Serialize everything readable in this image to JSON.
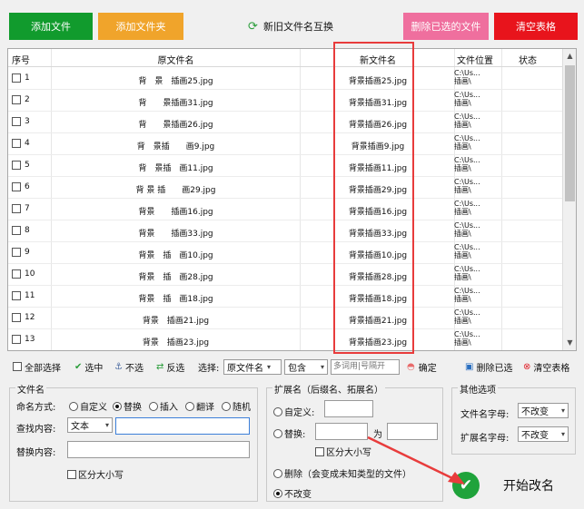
{
  "toolbar": {
    "add_file": "添加文件",
    "add_folder": "添加文件夹",
    "swap": "新旧文件名互换",
    "delete_selected": "删除已选的文件",
    "clear_table": "清空表格"
  },
  "grid": {
    "headers": {
      "index": "序号",
      "original": "原文件名",
      "new": "新文件名",
      "location": "文件位置",
      "status": "状态"
    },
    "rows": [
      {
        "index": "1",
        "original": "背　景　插画25.jpg",
        "new": "背景插画25.jpg",
        "location": "C:\\Us...\n插画\\"
      },
      {
        "index": "2",
        "original": "背　　景插画31.jpg",
        "new": "背景插画31.jpg",
        "location": "C:\\Us...\n插画\\"
      },
      {
        "index": "3",
        "original": "背　　景插画26.jpg",
        "new": "背景插画26.jpg",
        "location": "C:\\Us...\n插画\\"
      },
      {
        "index": "4",
        "original": "背　景插　　画9.jpg",
        "new": "背景插画9.jpg",
        "location": "C:\\Us...\n插画\\"
      },
      {
        "index": "5",
        "original": "背　景插　画11.jpg",
        "new": "背景插画11.jpg",
        "location": "C:\\Us...\n插画\\"
      },
      {
        "index": "6",
        "original": "背 景 插　　画29.jpg",
        "new": "背景插画29.jpg",
        "location": "C:\\Us...\n插画\\"
      },
      {
        "index": "7",
        "original": "背景　　插画16.jpg",
        "new": "背景插画16.jpg",
        "location": "C:\\Us...\n插画\\"
      },
      {
        "index": "8",
        "original": "背景　　插画33.jpg",
        "new": "背景插画33.jpg",
        "location": "C:\\Us...\n插画\\"
      },
      {
        "index": "9",
        "original": "背景　插　画10.jpg",
        "new": "背景插画10.jpg",
        "location": "C:\\Us...\n插画\\"
      },
      {
        "index": "10",
        "original": "背景　插　画28.jpg",
        "new": "背景插画28.jpg",
        "location": "C:\\Us...\n插画\\"
      },
      {
        "index": "11",
        "original": "背景　插　画18.jpg",
        "new": "背景插画18.jpg",
        "location": "C:\\Us...\n插画\\"
      },
      {
        "index": "12",
        "original": "背景　插画21.jpg",
        "new": "背景插画21.jpg",
        "location": "C:\\Us...\n插画\\"
      },
      {
        "index": "13",
        "original": "背景　插画23.jpg",
        "new": "背景插画23.jpg",
        "location": "C:\\Us...\n插画\\"
      }
    ]
  },
  "selbar": {
    "select_all": "全部选择",
    "select": "选中",
    "unselect": "不选",
    "invert": "反选",
    "choose_label": "选择:",
    "column_option": "原文件名",
    "mode_option": "包含",
    "keyword_placeholder": "多词用|号隔开",
    "confirm": "确定",
    "delete_selected": "删除已选",
    "clear_table": "清空表格"
  },
  "filename": {
    "legend": "文件名",
    "mode_label": "命名方式:",
    "modes": [
      "自定义",
      "替换",
      "插入",
      "翻译",
      "随机"
    ],
    "find_label": "查找内容:",
    "find_type": "文本",
    "find_value": "",
    "replace_label": "替换内容:",
    "replace_value": "",
    "case_label": "区分大小写"
  },
  "ext": {
    "legend": "扩展名（后缀名、拓展名）",
    "custom": "自定义:",
    "replace": "替换:",
    "to": "为",
    "case": "区分大小写",
    "delete": "删除（会变成未知类型的文件）",
    "keep": "不改变"
  },
  "other": {
    "legend": "其他选项",
    "name_case_label": "文件名字母:",
    "name_case_value": "不改变",
    "ext_case_label": "扩展名字母:",
    "ext_case_value": "不改变"
  },
  "start_label": "开始改名"
}
